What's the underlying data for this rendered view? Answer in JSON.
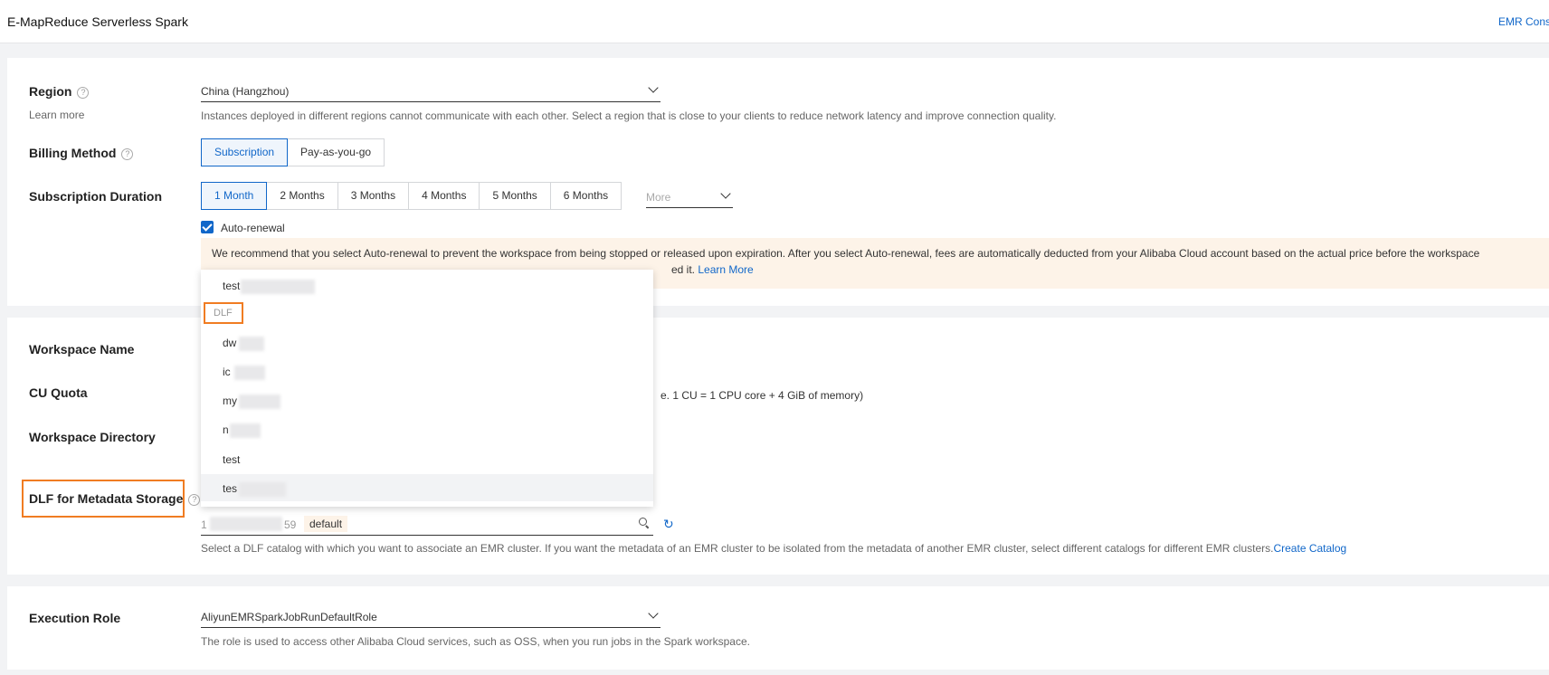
{
  "header": {
    "title": "E-MapReduce Serverless Spark",
    "console_link": "EMR Console"
  },
  "region": {
    "label": "Region",
    "learn_more": "Learn more",
    "value": "China (Hangzhou)",
    "description": "Instances deployed in different regions cannot communicate with each other. Select a region that is close to your clients to reduce network latency and improve connection quality."
  },
  "billing": {
    "label": "Billing Method",
    "options": [
      "Subscription",
      "Pay-as-you-go"
    ],
    "selected": "Subscription"
  },
  "duration": {
    "label": "Subscription Duration",
    "options": [
      "1 Month",
      "2 Months",
      "3 Months",
      "4 Months",
      "5 Months",
      "6 Months"
    ],
    "selected": "1 Month",
    "more_placeholder": "More",
    "auto_renewal": "Auto-renewal",
    "notice_line1": "We recommend that you select Auto-renewal to prevent the workspace from being stopped or released upon expiration. After you select Auto-renewal, fees are automatically deducted from your Alibaba Cloud account based on the actual price before the workspace",
    "notice_line2_tail": "ed it.",
    "notice_link": "Learn More"
  },
  "workspace": {
    "name_label": "Workspace Name",
    "cu_label": "CU Quota",
    "cu_desc_tail": "e. 1 CU = 1 CPU core + 4 GiB of memory)",
    "dir_label": "Workspace Directory"
  },
  "dlf": {
    "label": "DLF for Metadata Storage",
    "catalog_prefix": "1",
    "catalog_suffix": "59",
    "tag": "default",
    "description": "Select a DLF catalog with which you want to associate an EMR cluster. If you want the metadata of an EMR cluster to be isolated from the metadata of another EMR cluster, select different catalogs for different EMR clusters.",
    "create_link": "Create Catalog"
  },
  "dropdown": {
    "group_label": "DLF",
    "items": [
      "test",
      "dw",
      "ic",
      "my",
      "n",
      "test",
      "tes"
    ]
  },
  "execution_role": {
    "label": "Execution Role",
    "value": "AliyunEMRSparkJobRunDefaultRole",
    "description": "The role is used to access other Alibaba Cloud services, such as OSS, when you run jobs in the Spark workspace."
  }
}
